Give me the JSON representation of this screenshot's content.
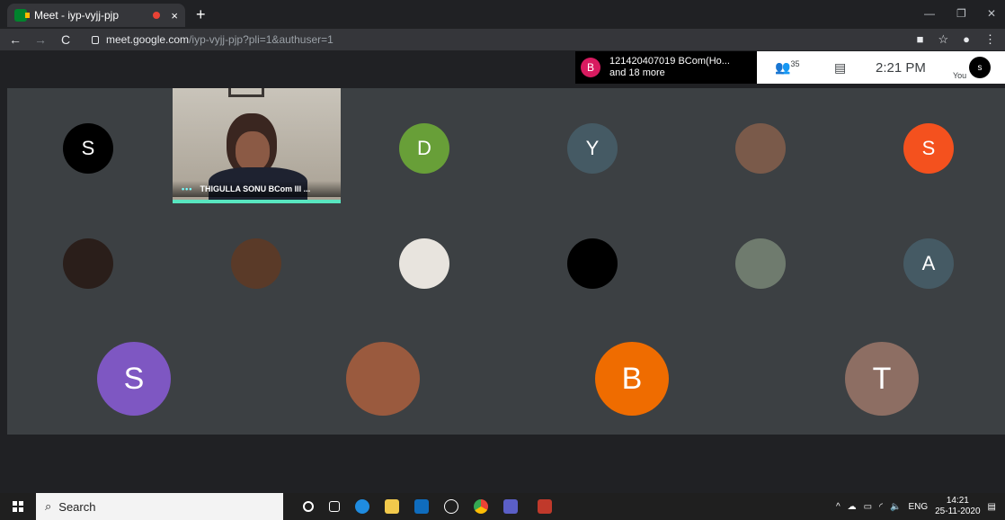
{
  "browser": {
    "tab_title": "Meet - iyp-vyjj-pjp",
    "tab_close": "×",
    "new_tab": "+",
    "url_host": "meet.google.com",
    "url_path": "/iyp-vyjj-pjp?pli=1&authuser=1"
  },
  "meet": {
    "presenting_initial": "B",
    "presenting_line1": "121420407019 BCom(Ho...",
    "presenting_line2": "and 18 more",
    "participants_count": "35",
    "time": "2:21 PM",
    "self_initial": "s",
    "self_label": "You",
    "video_tile_name": "THIGULLA SONU BCom III ...",
    "speaking_dots": "•••"
  },
  "participants": [
    {
      "initial": "S",
      "color": "#000000"
    },
    {
      "initial": "D",
      "color": "#689f38"
    },
    {
      "initial": "Y",
      "color": "#455a64"
    },
    {
      "initial": "",
      "color": "#7a5a4a"
    },
    {
      "initial": "S",
      "color": "#f4511e"
    },
    {
      "initial": "",
      "color": "#2a1e1a"
    },
    {
      "initial": "",
      "color": "#5a3a28"
    },
    {
      "initial": "",
      "color": "#e8e4de"
    },
    {
      "initial": "",
      "color": "#000000"
    },
    {
      "initial": "",
      "color": "#6f7b6e"
    },
    {
      "initial": "A",
      "color": "#455a64"
    },
    {
      "initial": "S",
      "color": "#7e57c2"
    },
    {
      "initial": "",
      "color": "#9a5a3e"
    },
    {
      "initial": "B",
      "color": "#ef6c00"
    },
    {
      "initial": "T",
      "color": "#8d6e63"
    }
  ],
  "taskbar": {
    "search_placeholder": "Search",
    "lang": "ENG",
    "time": "14:21",
    "date": "25-11-2020"
  }
}
